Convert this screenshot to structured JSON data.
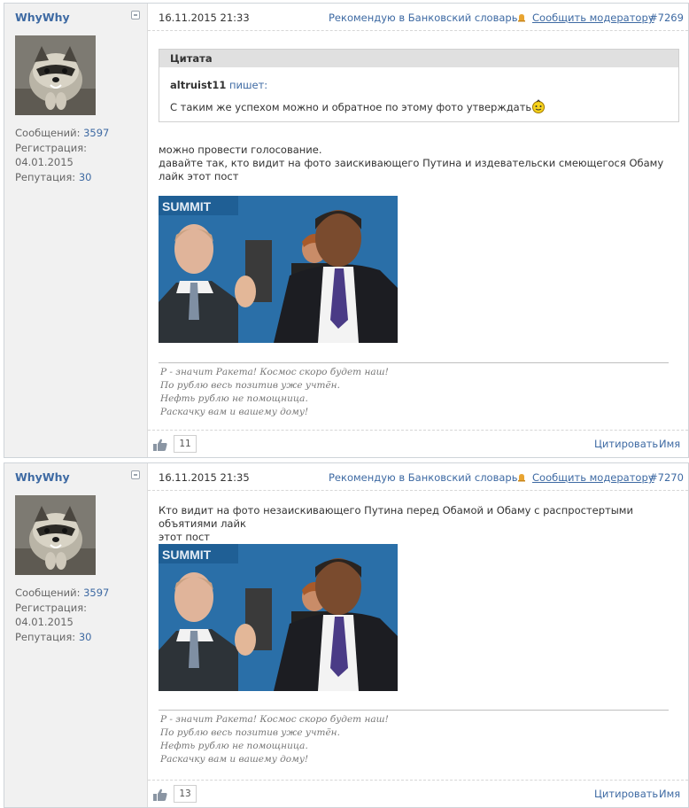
{
  "posts": [
    {
      "username": "WhyWhy",
      "stats": {
        "messages_label": "Сообщений:",
        "messages": "3597",
        "registration_label": "Регистрация:",
        "registration": "04.01.2015",
        "reputation_label": "Репутация:",
        "reputation": "30"
      },
      "date": "16.11.2015 21:33",
      "recommend": "Рекомендую в Банковский словарь",
      "report": "Сообщить модератору",
      "number": "#7269",
      "quote": {
        "title": "Цитата",
        "author": "altruist11",
        "writes": "пишет:",
        "text": "С таким же успехом можно и обратное по этому фото утверждать"
      },
      "message": [
        "можно провести голосование.",
        "давайте так, кто видит на фото заискивающего Путина и издевательски смеющегося Обаму лайк этот пост"
      ],
      "likes": "11"
    },
    {
      "username": "WhyWhy",
      "stats": {
        "messages_label": "Сообщений:",
        "messages": "3597",
        "registration_label": "Регистрация:",
        "registration": "04.01.2015",
        "reputation_label": "Репутация:",
        "reputation": "30"
      },
      "date": "16.11.2015 21:35",
      "recommend": "Рекомендую в Банковский словарь",
      "report": "Сообщить модератору",
      "number": "#7270",
      "message": [
        "Кто видит на фото незаискивающего Путина перед Обамой и Обаму с распростертыми объятиями лайк",
        "этот пост"
      ],
      "likes": "13"
    }
  ],
  "signature": [
    "Р - значит Ракета! Космос скоро будет наш!",
    "По рублю весь позитив уже учтён.",
    "Нефть рублю не помощница.",
    "Раскачку вам и вашему дому!"
  ],
  "footer": {
    "quote_label": "Цитировать",
    "name_label": "Имя"
  },
  "photo_banner": "SUMMIT",
  "colors": {
    "link": "#3e6aa3",
    "sidebar": "#f1f1f1",
    "photo_bg": "#2a6fa8"
  }
}
